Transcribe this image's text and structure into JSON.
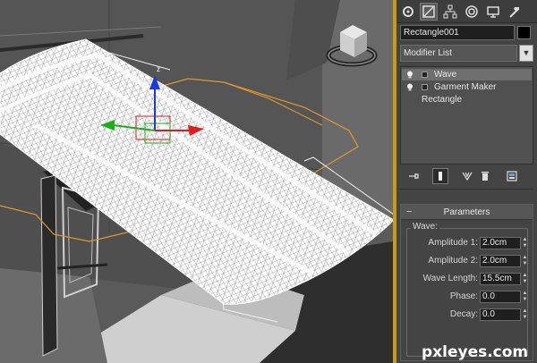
{
  "object": {
    "name": "Rectangle001",
    "color": "#000000"
  },
  "modifier_list": {
    "label": "Modifier List"
  },
  "stack": {
    "items": [
      {
        "label": "Wave",
        "selected": true
      },
      {
        "label": "Garment Maker",
        "selected": false
      },
      {
        "label": "Rectangle",
        "selected": false
      }
    ]
  },
  "command_tabs": [
    "create-icon",
    "modify-icon",
    "hierarchy-icon",
    "motion-icon",
    "display-icon",
    "utilities-icon"
  ],
  "stack_tools": [
    "pin-stack-icon",
    "show-end-result-icon",
    "make-unique-icon",
    "remove-modifier-icon",
    "configure-sets-icon"
  ],
  "parameters": {
    "title": "Parameters",
    "group": "Wave:",
    "fields": [
      {
        "label": "Amplitude 1:",
        "value": "2.0cm"
      },
      {
        "label": "Amplitude 2:",
        "value": "2.0cm"
      },
      {
        "label": "Wave Length:",
        "value": "15.5cm"
      },
      {
        "label": "Phase:",
        "value": "0.0"
      },
      {
        "label": "Decay:",
        "value": "0.0"
      }
    ]
  },
  "gizmo": {
    "z_label": "z",
    "y_label": "y",
    "x_label": "x"
  },
  "watermark": "pxleyes.com",
  "colors": {
    "accent_border": "#c79b1a",
    "selection_outline": "#e09a2a",
    "gizmo_x": "#e01c1c",
    "gizmo_y": "#1ab01a",
    "gizmo_z": "#1a3ae0"
  }
}
